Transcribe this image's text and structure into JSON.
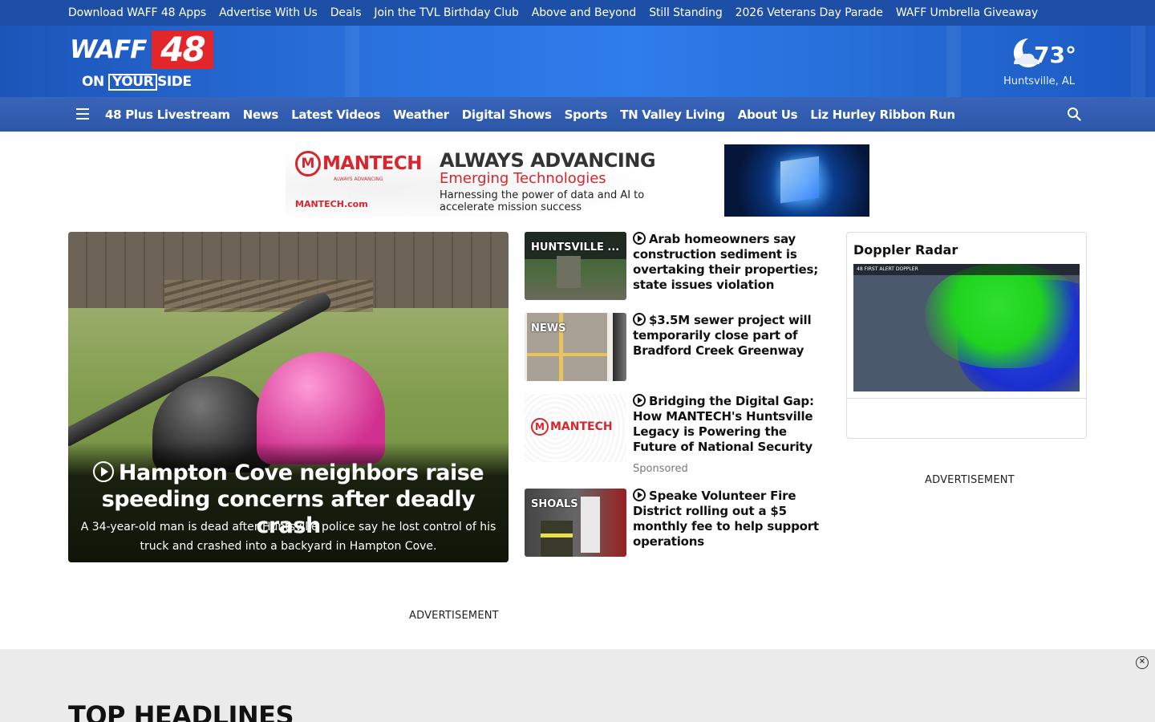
{
  "utility_links": [
    "Download WAFF 48 Apps",
    "Advertise With Us",
    "Deals",
    "Join the TVL Birthday Club",
    "Above and Beyond",
    "Still Standing",
    "2026 Veterans Day Parade",
    "WAFF Umbrella Giveaway"
  ],
  "brand": {
    "logo_name": "WAFF",
    "logo_number": "48",
    "logo_tag_pre": "ON",
    "logo_tag_box": "YOUR",
    "logo_tag_post": "SIDE"
  },
  "weather": {
    "temp": "73°",
    "city": "Huntsville, AL",
    "icon": "moon-cloud-icon"
  },
  "nav_items": [
    "48 Plus Livestream",
    "News",
    "Latest Videos",
    "Weather",
    "Digital Shows",
    "Sports",
    "TN Valley Living",
    "About Us",
    "Liz Hurley Ribbon Run"
  ],
  "ad": {
    "brand_mark": "M",
    "brand": "MANTECH",
    "brand_tag": "ALWAYS ADVANCING",
    "url": "MANTECH.com",
    "headline": "ALWAYS ADVANCING",
    "sub": "Emerging Technologies",
    "body": "Harnessing the power of data and AI to accelerate mission success"
  },
  "hero": {
    "title": "Hampton Cove neighbors raise speeding concerns after deadly crash",
    "description": "A 34-year-old man is dead after Huntsville police say he lost control of his truck and crashed into a backyard in Hampton Cove."
  },
  "stories": [
    {
      "label": "HUNTSVILLE ...",
      "headline": "Arab homeowners say construction sediment is overtaking their properties; state issues violation",
      "sponsored": ""
    },
    {
      "label": "NEWS",
      "headline": "$3.5M sewer project will temporarily close part of Bradford Creek Greenway",
      "sponsored": ""
    },
    {
      "label": "",
      "thumb_brand": "MANTECH",
      "headline": "Bridging the Digital Gap: How MANTECH's Huntsville Legacy is Powering the Future of National Security",
      "sponsored": "Sponsored"
    },
    {
      "label": "SHOALS",
      "headline": "Speake Volunteer Fire District rolling out a $5 monthly fee to help support operations",
      "sponsored": ""
    }
  ],
  "doppler": {
    "title": "Doppler Radar",
    "banner": "48 FIRST ALERT DOPPLER"
  },
  "advertisement_label": "ADVERTISEMENT",
  "section_title": "TOP HEADLINES"
}
